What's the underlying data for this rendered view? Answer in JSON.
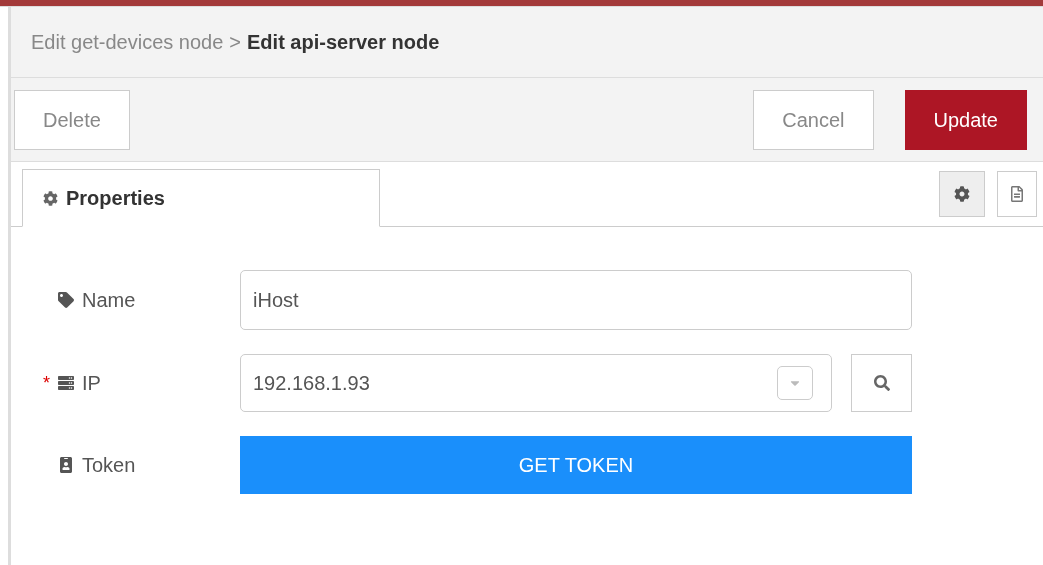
{
  "breadcrumb": {
    "parent": "Edit get-devices node",
    "separator": ">",
    "current": "Edit api-server node"
  },
  "toolbar": {
    "delete": "Delete",
    "cancel": "Cancel",
    "update": "Update"
  },
  "tabs": [
    {
      "label": "Properties",
      "selected": true
    }
  ],
  "fields": [
    {
      "kind": "text",
      "label": "Name",
      "value": "iHost"
    },
    {
      "kind": "select",
      "label": "IP",
      "required_mark": "*",
      "value": "192.168.1.93"
    },
    {
      "kind": "button",
      "label": "Token",
      "button_label": "GET TOKEN"
    }
  ]
}
